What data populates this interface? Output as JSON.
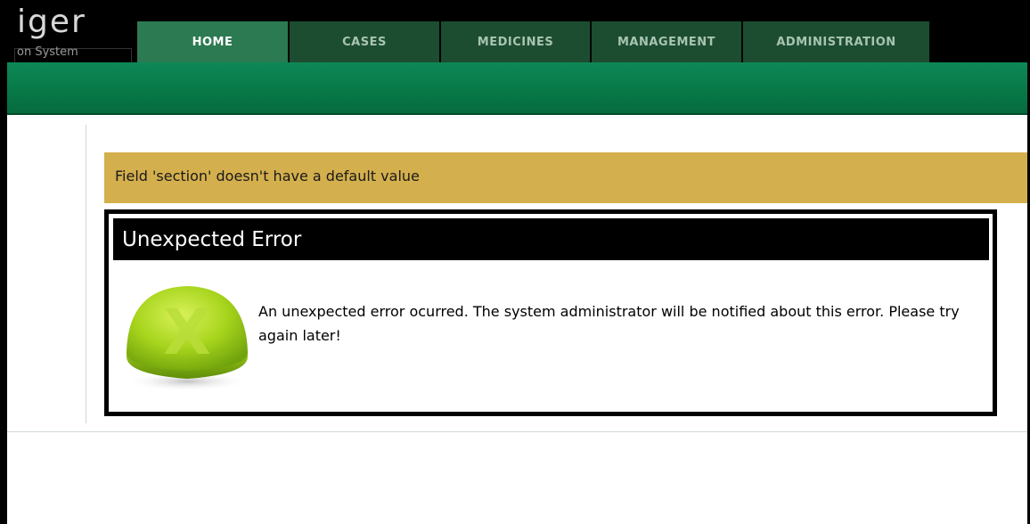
{
  "app": {
    "logo_text": "iger",
    "logo_subtitle": "on System"
  },
  "nav": {
    "tabs": [
      {
        "label": "HOME",
        "active": true
      },
      {
        "label": "CASES",
        "active": false
      },
      {
        "label": "MEDICINES",
        "active": false
      },
      {
        "label": "MANAGEMENT",
        "active": false
      },
      {
        "label": "ADMINISTRATION",
        "active": false
      }
    ]
  },
  "alert": {
    "message": "Field 'section' doesn't have a default value"
  },
  "error": {
    "title": "Unexpected Error",
    "icon": "x-icon",
    "message": "An unexpected error ocurred. The system administrator will be notified about this error. Please try again later!"
  },
  "colors": {
    "nav_active": "#2c7a52",
    "nav_inactive": "#1d4d31",
    "green_bar": "#077746",
    "alert_bg": "#d4af4d",
    "icon_green": "#a6d41c"
  }
}
